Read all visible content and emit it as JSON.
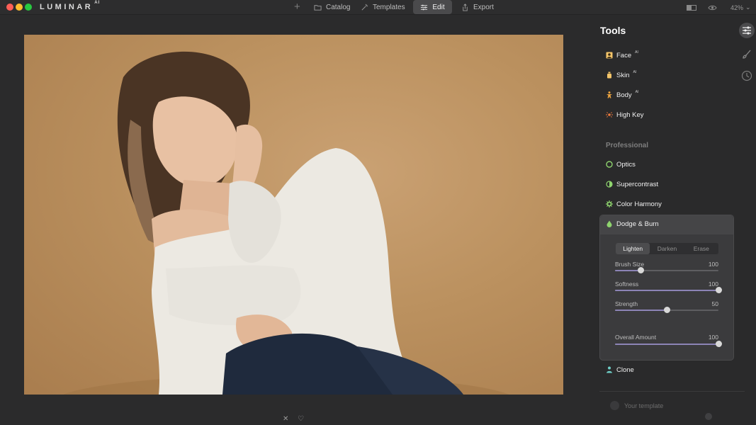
{
  "app": {
    "logo": "LUMINAR",
    "logo_suffix": "AI"
  },
  "nav": {
    "catalog": "Catalog",
    "templates": "Templates",
    "edit": "Edit",
    "export": "Export"
  },
  "toolbar": {
    "zoom": "42%"
  },
  "tools": {
    "title": "Tools",
    "ai_badge": "AI",
    "face": "Face",
    "skin": "Skin",
    "body": "Body",
    "high_key": "High Key",
    "section_professional": "Professional",
    "optics": "Optics",
    "supercontrast": "Supercontrast",
    "color_harmony": "Color Harmony",
    "dodge_burn": "Dodge & Burn",
    "clone": "Clone"
  },
  "dodge_burn": {
    "modes": [
      "Lighten",
      "Darken",
      "Erase"
    ],
    "active_mode": "Lighten",
    "sliders": [
      {
        "label": "Brush Size",
        "value": 100,
        "position": 0.25
      },
      {
        "label": "Softness",
        "value": 100,
        "position": 1.0
      },
      {
        "label": "Strength",
        "value": 50,
        "position": 0.5
      },
      {
        "label": "Overall Amount",
        "value": 100,
        "position": 1.0
      }
    ]
  },
  "footer": {
    "template_label": "Your template"
  },
  "colors": {
    "accent_slider": "#8c84b6",
    "background": "#2b2b2c",
    "panel": "#2a2a2b",
    "photo_backdrop": "#bb915f"
  }
}
